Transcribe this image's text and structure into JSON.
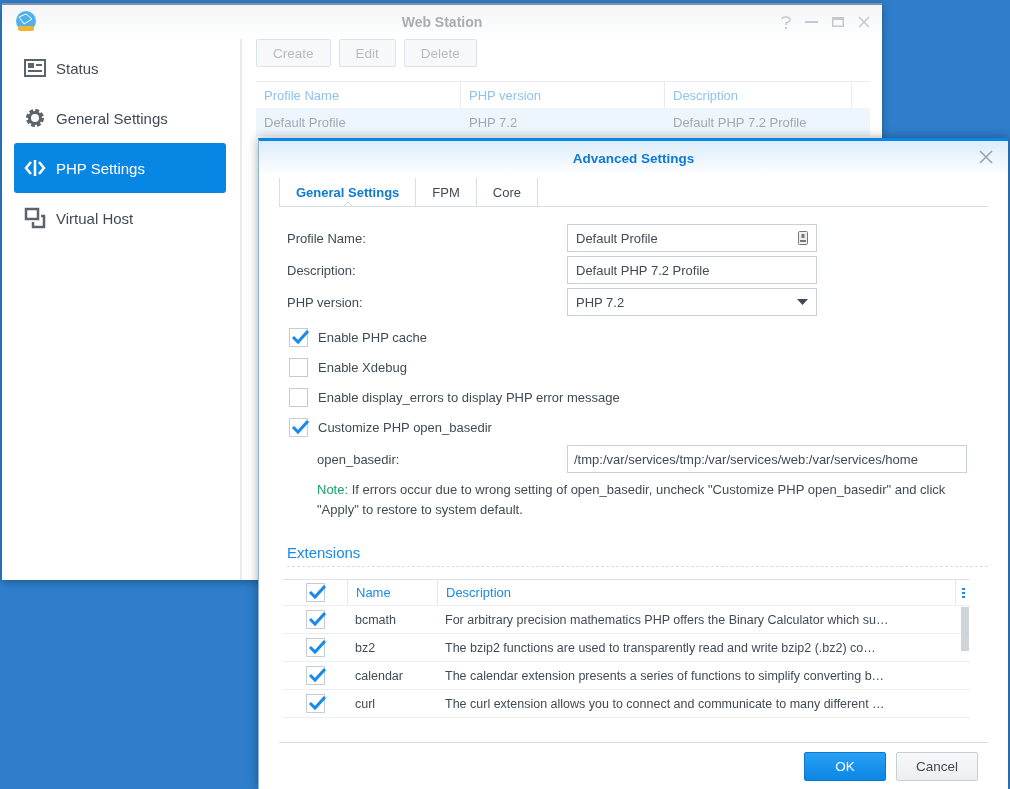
{
  "main_window": {
    "title": "Web Station"
  },
  "sidebar": {
    "items": [
      {
        "label": "Status",
        "kind": "status",
        "selected": false
      },
      {
        "label": "General Settings",
        "kind": "gear",
        "selected": false
      },
      {
        "label": "PHP Settings",
        "kind": "code",
        "selected": true
      },
      {
        "label": "Virtual Host",
        "kind": "hosts",
        "selected": false
      }
    ]
  },
  "toolbar": {
    "buttons": [
      "Create",
      "Edit",
      "Delete"
    ]
  },
  "profiles_table": {
    "columns": [
      "Profile Name",
      "PHP version",
      "Description"
    ],
    "rows": [
      {
        "cells": [
          "Default Profile",
          "PHP 7.2",
          "Default PHP 7.2 Profile"
        ],
        "selected": true
      }
    ]
  },
  "dialog": {
    "title": "Advanced Settings",
    "tabs": [
      {
        "label": "General Settings",
        "selected": true
      },
      {
        "label": "FPM",
        "selected": false
      },
      {
        "label": "Core",
        "selected": false
      }
    ],
    "fields": [
      {
        "label": "Profile Name:",
        "value": "Default Profile",
        "kind": "text-icon"
      },
      {
        "label": "Description:",
        "value": "Default PHP 7.2 Profile",
        "kind": "text"
      },
      {
        "label": "PHP version:",
        "value": "PHP 7.2",
        "kind": "select"
      }
    ],
    "options": [
      {
        "label": "Enable PHP cache",
        "checked": true
      },
      {
        "label": "Enable Xdebug",
        "checked": false
      },
      {
        "label": "Enable display_errors to display PHP error message",
        "checked": false
      },
      {
        "label": "Customize PHP open_basedir",
        "checked": true
      }
    ],
    "open_basedir": {
      "label": "open_basedir:",
      "value": "/tmp:/var/services/tmp:/var/services/web:/var/services/home"
    },
    "note": {
      "label": "Note:",
      "text": "If errors occur due to wrong setting of open_basedir, uncheck \"Customize PHP open_basedir\" and click \"Apply\" to restore to system default."
    },
    "extensions": {
      "title": "Extensions",
      "all_checked": true,
      "columns": [
        "Name",
        "Description"
      ],
      "rows": [
        {
          "name": "bcmath",
          "description": "For arbitrary precision mathematics PHP offers the Binary Calculator which su…",
          "checked": true
        },
        {
          "name": "bz2",
          "description": "The bzip2 functions are used to transparently read and write bzip2 (.bz2) co…",
          "checked": true
        },
        {
          "name": "calendar",
          "description": "The calendar extension presents a series of functions to simplify converting b…",
          "checked": true
        },
        {
          "name": "curl",
          "description": "The curl extension allows you to connect and communicate to many different …",
          "checked": true
        }
      ]
    },
    "buttons": [
      {
        "label": "OK",
        "kind": "primary"
      },
      {
        "label": "Cancel",
        "kind": "secondary"
      }
    ]
  }
}
